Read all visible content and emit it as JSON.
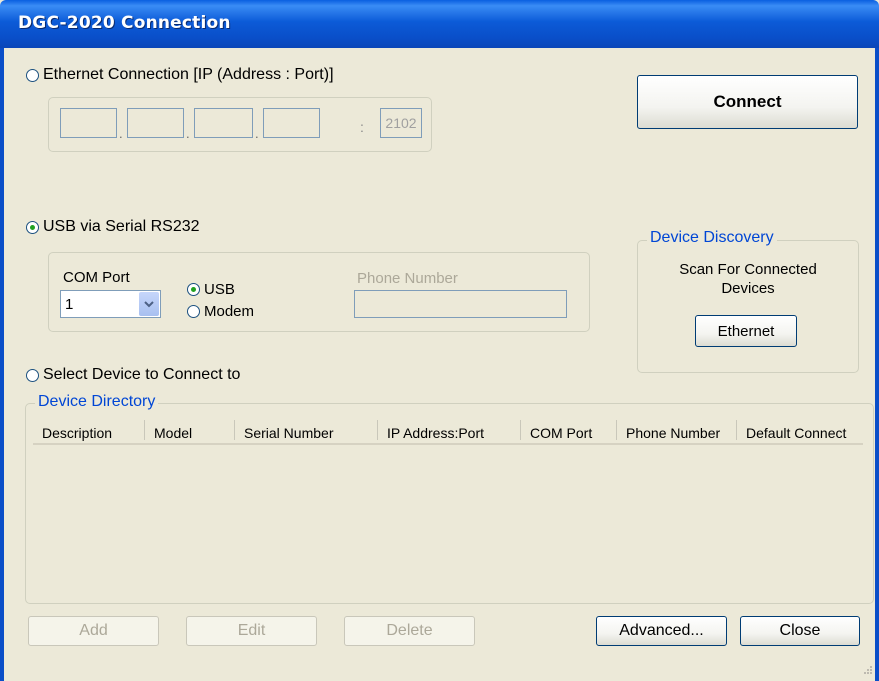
{
  "window": {
    "title": "DGC-2020 Connection"
  },
  "ethernet": {
    "radio_label": "Ethernet Connection [IP (Address : Port)]",
    "selected": false,
    "ip_octets": [
      "",
      "",
      "",
      ""
    ],
    "dot": ".",
    "colon": ":",
    "port": "2102"
  },
  "connect_button": "Connect",
  "usb": {
    "radio_label": "USB via Serial RS232",
    "selected": true,
    "com_port_label": "COM Port",
    "com_port_value": "1",
    "mode_usb": "USB",
    "mode_modem": "Modem",
    "mode_selected": "USB",
    "phone_label": "Phone Number",
    "phone_value": ""
  },
  "discovery": {
    "legend": "Device Discovery",
    "text": "Scan For Connected\nDevices",
    "button": "Ethernet"
  },
  "select_device": {
    "radio_label": "Select Device to Connect to",
    "selected": false
  },
  "directory": {
    "legend": "Device Directory",
    "columns": [
      "Description",
      "Model",
      "Serial Number",
      "IP Address:Port",
      "COM Port",
      "Phone Number",
      "Default Connect"
    ],
    "rows": []
  },
  "buttons": {
    "add": "Add",
    "edit": "Edit",
    "delete": "Delete",
    "advanced": "Advanced...",
    "close": "Close"
  },
  "colors": {
    "titlebar": "#0a4ec8",
    "legend": "#0046d5",
    "background": "#ece9d8",
    "radio_check": "#21a121"
  }
}
